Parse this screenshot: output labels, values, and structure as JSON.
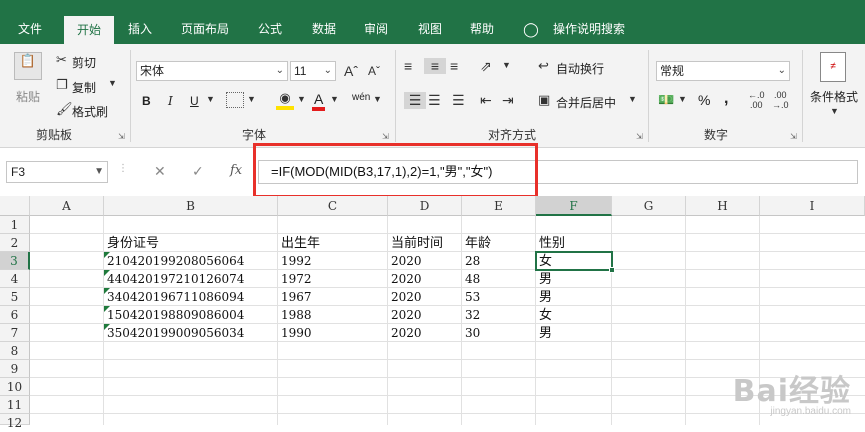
{
  "tabs": [
    {
      "label": "文件",
      "active": false
    },
    {
      "label": "开始",
      "active": true
    },
    {
      "label": "插入",
      "active": false
    },
    {
      "label": "页面布局",
      "active": false
    },
    {
      "label": "公式",
      "active": false
    },
    {
      "label": "数据",
      "active": false
    },
    {
      "label": "审阅",
      "active": false
    },
    {
      "label": "视图",
      "active": false
    },
    {
      "label": "帮助",
      "active": false
    },
    {
      "label": "操作说明搜索",
      "active": false
    }
  ],
  "ribbon": {
    "clipboard": {
      "group": "剪贴板",
      "paste": "粘贴",
      "cut": "剪切",
      "copy": "复制",
      "format_painter": "格式刷"
    },
    "font": {
      "group": "字体",
      "name": "宋体",
      "size": "11",
      "bold": "B",
      "italic": "I",
      "underline": "U",
      "font_color_letter": "A",
      "phonetic": "wén"
    },
    "alignment": {
      "group": "对齐方式",
      "wrap": "自动换行",
      "merge": "合并后居中"
    },
    "number": {
      "group": "数字",
      "format": "常规",
      "percent": "%",
      "comma": ","
    },
    "styles": {
      "conditional": "条件格式"
    }
  },
  "formula_bar": {
    "name_box": "F3",
    "fx": "fx",
    "formula": "=IF(MOD(MID(B3,17,1),2)=1,\"男\",\"女\")"
  },
  "columns": [
    "A",
    "B",
    "C",
    "D",
    "E",
    "F",
    "G",
    "H",
    "I"
  ],
  "rows": [
    "1",
    "2",
    "3",
    "4",
    "5",
    "6",
    "7",
    "8",
    "9",
    "10",
    "11",
    "12"
  ],
  "headers": {
    "id": "身份证号",
    "birth_year": "出生年",
    "current_time": "当前时间",
    "age": "年龄",
    "gender": "性别"
  },
  "table": [
    {
      "id": "210420199208056064",
      "birth_year": "1992",
      "current_time": "2020",
      "age": "28",
      "gender": "女"
    },
    {
      "id": "440420197210126074",
      "birth_year": "1972",
      "current_time": "2020",
      "age": "48",
      "gender": "男"
    },
    {
      "id": "340420196711086094",
      "birth_year": "1967",
      "current_time": "2020",
      "age": "53",
      "gender": "男"
    },
    {
      "id": "150420198809086004",
      "birth_year": "1988",
      "current_time": "2020",
      "age": "32",
      "gender": "女"
    },
    {
      "id": "350420199009056034",
      "birth_year": "1990",
      "current_time": "2020",
      "age": "30",
      "gender": "男"
    }
  ],
  "selected_cell": "F3",
  "watermark": {
    "brand": "Bai经验",
    "url": "jingyan.baidu.com"
  },
  "colors": {
    "excel_green": "#217346",
    "highlight_red": "#e8302a"
  }
}
